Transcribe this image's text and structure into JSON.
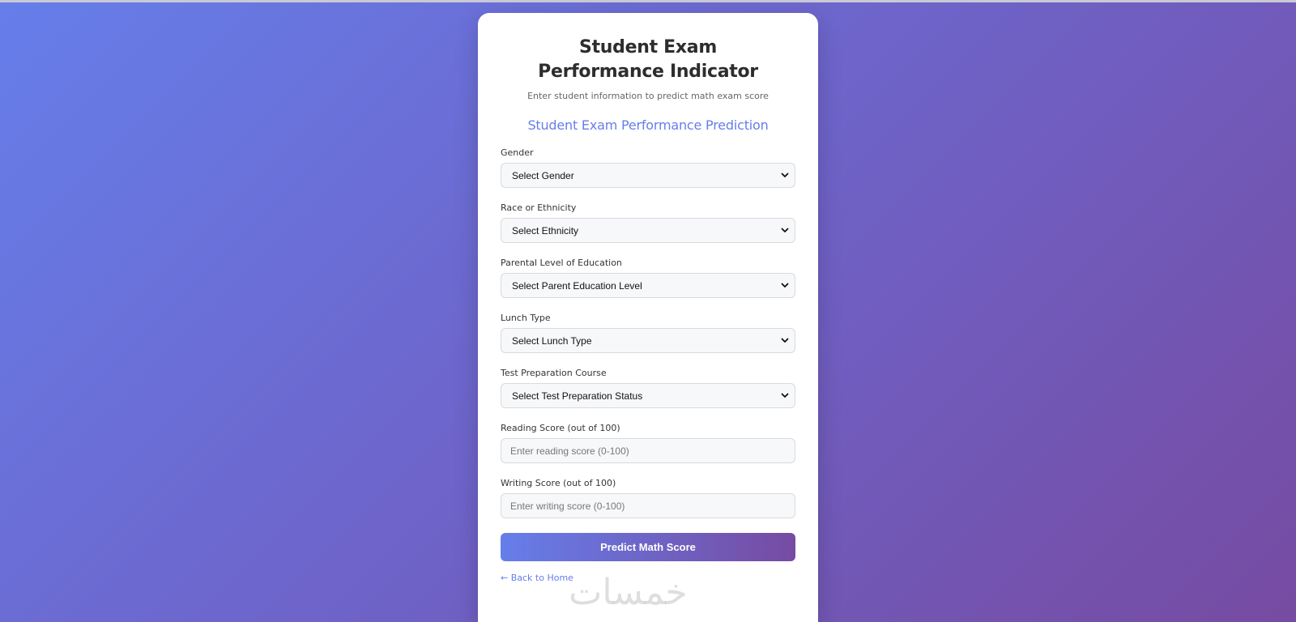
{
  "header": {
    "title": "Student Exam Performance Indicator",
    "subtitle": "Enter student information to predict math exam score"
  },
  "form": {
    "section_title": "Student Exam Performance Prediction",
    "fields": {
      "gender": {
        "label": "Gender",
        "value": "Select Gender"
      },
      "ethnicity": {
        "label": "Race or Ethnicity",
        "value": "Select Ethnicity"
      },
      "parental_education": {
        "label": "Parental Level of Education",
        "value": "Select Parent Education Level"
      },
      "lunch": {
        "label": "Lunch Type",
        "value": "Select Lunch Type"
      },
      "test_prep": {
        "label": "Test Preparation Course",
        "value": "Select Test Preparation Status"
      },
      "reading_score": {
        "label": "Reading Score (out of 100)",
        "placeholder": "Enter reading score (0-100)"
      },
      "writing_score": {
        "label": "Writing Score (out of 100)",
        "placeholder": "Enter writing score (0-100)"
      }
    },
    "submit_label": "Predict Math Score",
    "back_link": "← Back to Home"
  },
  "watermark": "خمسات",
  "colors": {
    "accent": "#667eea",
    "accent_end": "#764ba2",
    "card_bg": "#ffffff"
  },
  "icons": {
    "select_arrow": "chevron-down-icon"
  }
}
